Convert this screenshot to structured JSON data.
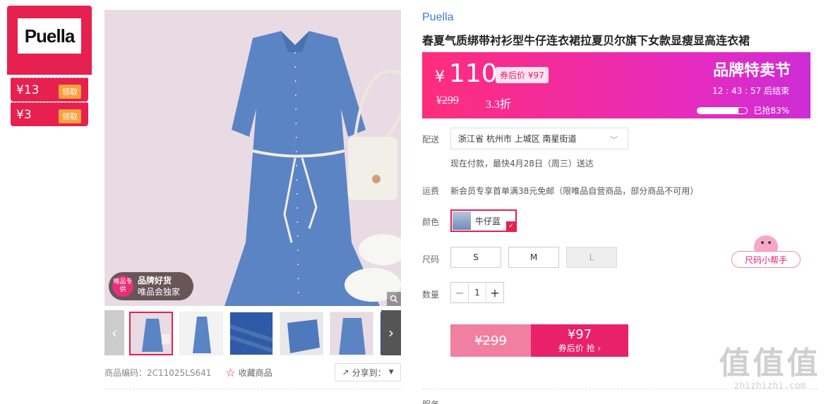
{
  "sidebar": {
    "brand_logo": "Puella",
    "coupons": [
      {
        "amount": "¥13",
        "action": "领取"
      },
      {
        "amount": "¥3",
        "action": "领取"
      }
    ]
  },
  "gallery": {
    "promo_badge": {
      "circle": "唯品专供",
      "line1": "品牌好货",
      "line2": "唯品会独家"
    },
    "thumbnail_count": 6,
    "product_code": "商品编码：2C11025LS641",
    "favorite_label": "收藏商品",
    "share_label": "分享到："
  },
  "product": {
    "brand": "Puella",
    "title": "春夏气质绑带衬衫型牛仔连衣裙拉夏贝尔旗下女款显瘦显高连衣裙"
  },
  "price": {
    "currency": "¥",
    "current": "110",
    "coupon_price": "券后价 ¥97",
    "original": "¥299",
    "discount": "3.3折",
    "sale_name": "品牌特卖节",
    "countdown": "12 : 43 : 57  后结束",
    "progress_label": "已抢83%",
    "progress_pct": 83
  },
  "delivery": {
    "label": "配送",
    "address": "浙江省 杭州市 上城区 南星街道",
    "note": "现在付款，最快4月28日（周三）送达"
  },
  "shipping": {
    "label": "运费",
    "note": "新会员专享首单满38元免邮（限唯品自营商品，部分商品不可用）"
  },
  "color": {
    "label": "颜色",
    "selected": "牛仔蓝"
  },
  "size": {
    "label": "尺码",
    "options": [
      "S",
      "M",
      "L"
    ],
    "helper": "尺码小帮手"
  },
  "quantity": {
    "label": "数量",
    "value": "1",
    "minus": "−",
    "plus": "+"
  },
  "buy": {
    "old_price": "¥299",
    "new_price": "¥97",
    "action": "券后价 抢 ›"
  },
  "service": {
    "label": "服务"
  },
  "watermark": {
    "big": "值值值",
    "small": "zhizhizhi.com"
  },
  "colors": {
    "accent": "#e6204f",
    "price_gradient_start": "#ff2d7b",
    "price_gradient_end": "#cc2dd6",
    "brand_link": "#3b7dd8"
  }
}
